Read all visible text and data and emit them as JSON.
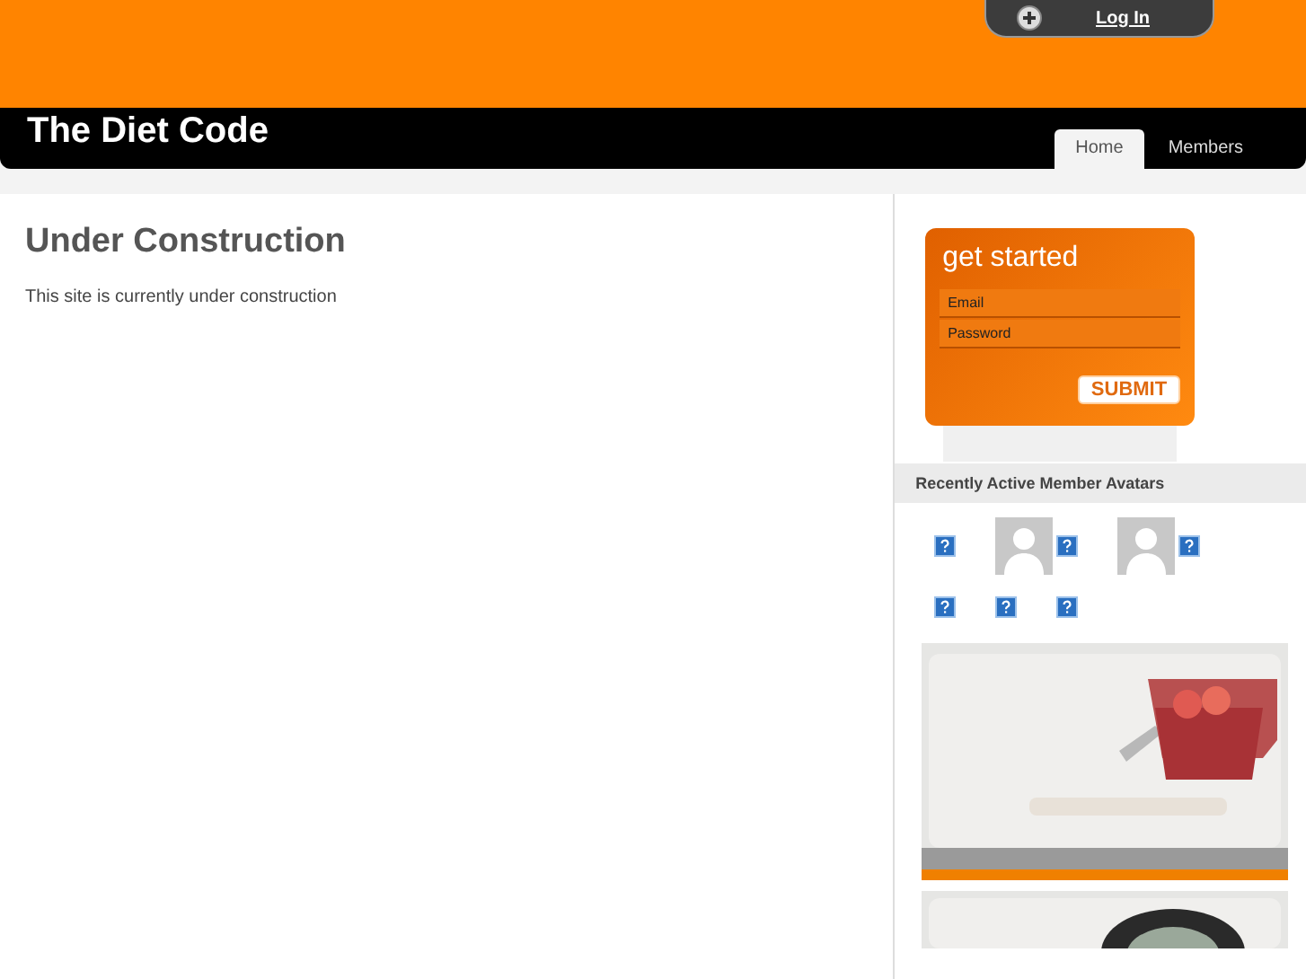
{
  "header": {
    "login_link": "Log In",
    "site_title": "The Diet Code"
  },
  "nav_tabs": [
    {
      "label": "Home",
      "selected": true
    },
    {
      "label": "Members",
      "selected": false
    }
  ],
  "main": {
    "heading": "Under Construction",
    "text": "This site is currently under construction"
  },
  "signup": {
    "title": "get started",
    "fields": [
      {
        "placeholder": "Email"
      },
      {
        "placeholder": "Password"
      }
    ],
    "button": "SUBMIT"
  },
  "avatars": {
    "heading": "Recently Active Member Avatars",
    "items": [
      {
        "kind": "broken"
      },
      {
        "kind": "silhouette"
      },
      {
        "kind": "broken"
      },
      {
        "kind": "silhouette"
      },
      {
        "kind": "broken"
      },
      {
        "kind": "broken"
      },
      {
        "kind": "broken"
      },
      {
        "kind": "broken"
      }
    ]
  }
}
